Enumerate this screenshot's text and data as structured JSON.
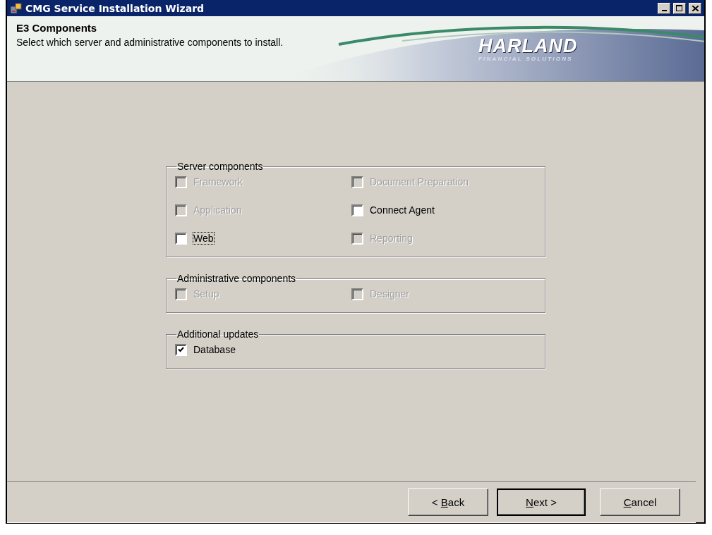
{
  "window": {
    "title": "CMG Service Installation Wizard"
  },
  "header": {
    "title": "E3 Components",
    "subtitle": "Select which server and administrative components to install.",
    "logo": {
      "name": "HARLAND",
      "tagline": "FINANCIAL SOLUTIONS"
    }
  },
  "groups": [
    {
      "title": "Server components",
      "items": [
        {
          "label": "Framework",
          "checked": false,
          "disabled": true,
          "focused": false
        },
        {
          "label": "Document Preparation",
          "checked": false,
          "disabled": true,
          "focused": false
        },
        {
          "label": "Application",
          "checked": false,
          "disabled": true,
          "focused": false
        },
        {
          "label": "Connect Agent",
          "checked": false,
          "disabled": false,
          "focused": false
        },
        {
          "label": "Web",
          "checked": false,
          "disabled": false,
          "focused": true
        },
        {
          "label": "Reporting",
          "checked": false,
          "disabled": true,
          "focused": false
        }
      ]
    },
    {
      "title": "Administrative components",
      "items": [
        {
          "label": "Setup",
          "checked": false,
          "disabled": true,
          "focused": false
        },
        {
          "label": "Designer",
          "checked": false,
          "disabled": true,
          "focused": false
        }
      ]
    },
    {
      "title": "Additional updates",
      "items": [
        {
          "label": "Database",
          "checked": true,
          "disabled": false,
          "focused": false
        }
      ]
    }
  ],
  "buttons": [
    {
      "prefix": "< ",
      "key": "B",
      "suffix": "ack",
      "default": false
    },
    {
      "key": "N",
      "suffix": "ext >",
      "default": true
    },
    {
      "key": "C",
      "suffix": "ancel",
      "default": false
    }
  ]
}
